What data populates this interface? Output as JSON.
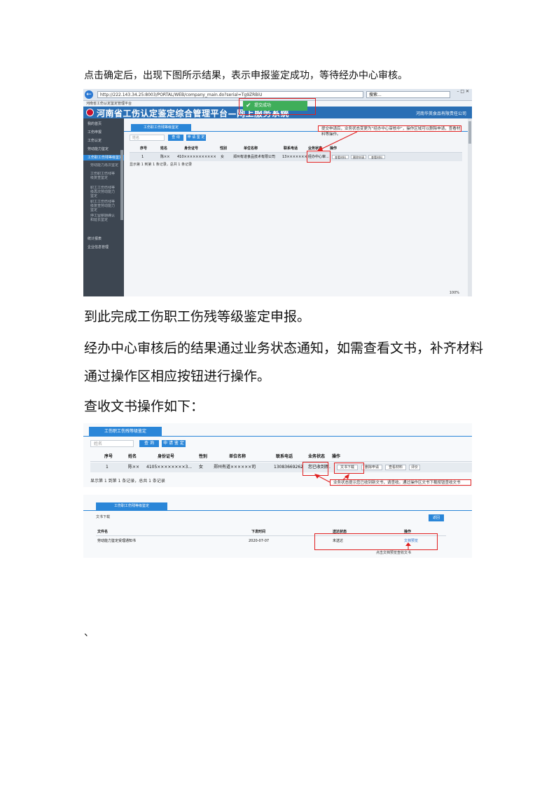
{
  "intro_text": "点击确定后，出现下图所示结果，表示申报鉴定成功，等待经办中心审核。",
  "screenshot1": {
    "browser": {
      "address": "http://222.143.34.25:8003/PORTAL/WEB/company_main.do?serial=Tg9ZRBiU",
      "search": "搜索...",
      "tab": "河南省工伤认定鉴定管理平台"
    },
    "app_title": "河南省工伤认定鉴定综合管理平台—网上服务系统",
    "company_name": "河南华英食品有限责任公司",
    "toast": "提交成功",
    "sidebar": {
      "items": [
        {
          "label": "我的首页"
        },
        {
          "label": "工伤申报"
        },
        {
          "label": "工伤认定"
        },
        {
          "label": "劳动能力鉴定"
        },
        {
          "label": "工伤职工伤残等级鉴定"
        },
        {
          "label": "劳动能力再次鉴定"
        },
        {
          "label": "工伤职工伤残等级复查鉴定"
        },
        {
          "label": "职工工伤伤残等级再次劳动能力鉴定"
        },
        {
          "label": "职工工伤伤残等级复查劳动能力鉴定"
        },
        {
          "label": "停工留薪期确认和延长鉴定"
        },
        {
          "label": "统计报表"
        },
        {
          "label": "企业信息管理"
        }
      ]
    },
    "tab": "工伤职工伤残等级鉴定",
    "search_placeholder": "姓名",
    "query_button": "查 询",
    "apply_button": "申 请 鉴 定",
    "table": {
      "headers": [
        "序号",
        "姓名",
        "身份证号",
        "性别",
        "单位名称",
        "联系电话",
        "业务状态",
        "操作"
      ],
      "row": [
        "1",
        "陈××",
        "410××××××××××××××50...",
        "女",
        "郑州有道食品技术有限公司",
        "13×××××××292",
        "经办中心审..."
      ]
    },
    "row_buttons": [
      "查看材料",
      "删除申请",
      "查看材料"
    ],
    "pager": "显示第 1 到第 1 条记录，总共 1 条记录",
    "callout": "提交申请后，业务状态变更为“经办中心审核中”，操作区域可以删除申请，查看材料等操作。",
    "zoom": "100%"
  },
  "para1": "到此完成工伤职工伤残等级鉴定申报。",
  "para2a": "经办中心审核后的结果通过业务状态通知，如需查看文书，补齐材料",
  "para2b": "通过操作区相应按钮进行操作。",
  "para3": "查收文书操作如下：",
  "screenshot2": {
    "tab": "工伤职工伤残等级鉴定",
    "search_placeholder": "姓名",
    "query_button": "查 询",
    "apply_button": "申 请 鉴 定",
    "table": {
      "headers": [
        "序号",
        "姓名",
        "身份证号",
        "性别",
        "单位名称",
        "联系电话",
        "业务状态",
        "操作"
      ],
      "row": [
        "1",
        "陈××",
        "4105××××××××3...",
        "女",
        "郑州有道××××××司",
        "13083669262",
        "您已收到新..."
      ]
    },
    "row_buttons": [
      "文书下载",
      "删除申请",
      "查看材料",
      "评价"
    ],
    "pager": "显示第 1 到第 1 条记录，总共 1 条记录",
    "callout": "业务状态提示您已收到新文书，请查收。通过操作区文书下载按钮查收文书"
  },
  "screenshot3": {
    "tab": "工伤职工伤残等级鉴定",
    "title": "文书下载",
    "back_button": "返回",
    "table": {
      "headers": [
        "文件名",
        "下发时间",
        "送达状态",
        "操作"
      ],
      "row": [
        "劳动能力鉴定受理通知书",
        "2020-07-07",
        "未送达",
        "文档预览"
      ]
    },
    "callout": "点击文档预览查收文书"
  },
  "trailing_mark": "、"
}
